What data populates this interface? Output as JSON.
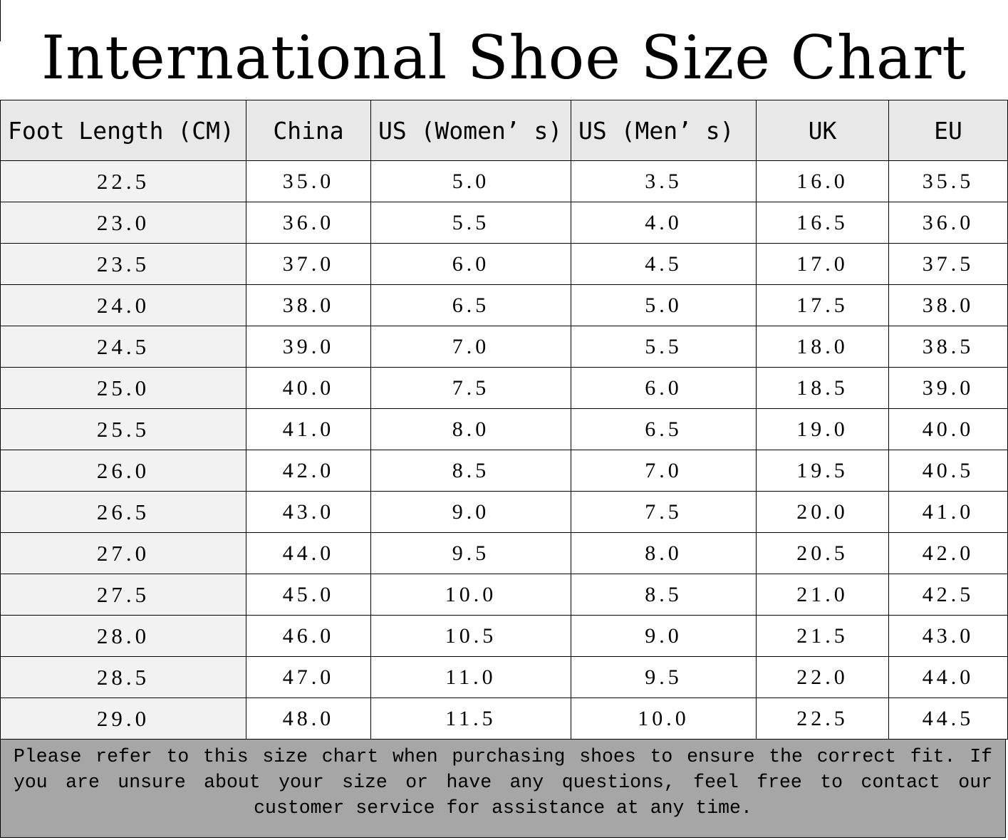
{
  "title": "International Shoe Size Chart",
  "table": {
    "headers": [
      "Foot Length (CM)",
      "China",
      "US (Women’ s)",
      "US (Men’ s)",
      "UK",
      "EU"
    ],
    "rows": [
      [
        "22.5",
        "35.0",
        "5.0",
        "3.5",
        "16.0",
        "35.5"
      ],
      [
        "23.0",
        "36.0",
        "5.5",
        "4.0",
        "16.5",
        "36.0"
      ],
      [
        "23.5",
        "37.0",
        "6.0",
        "4.5",
        "17.0",
        "37.5"
      ],
      [
        "24.0",
        "38.0",
        "6.5",
        "5.0",
        "17.5",
        "38.0"
      ],
      [
        "24.5",
        "39.0",
        "7.0",
        "5.5",
        "18.0",
        "38.5"
      ],
      [
        "25.0",
        "40.0",
        "7.5",
        "6.0",
        "18.5",
        "39.0"
      ],
      [
        "25.5",
        "41.0",
        "8.0",
        "6.5",
        "19.0",
        "40.0"
      ],
      [
        "26.0",
        "42.0",
        "8.5",
        "7.0",
        "19.5",
        "40.5"
      ],
      [
        "26.5",
        "43.0",
        "9.0",
        "7.5",
        "20.0",
        "41.0"
      ],
      [
        "27.0",
        "44.0",
        "9.5",
        "8.0",
        "20.5",
        "42.0"
      ],
      [
        "27.5",
        "45.0",
        "10.0",
        "8.5",
        "21.0",
        "42.5"
      ],
      [
        "28.0",
        "46.0",
        "10.5",
        "9.0",
        "21.5",
        "43.0"
      ],
      [
        "28.5",
        "47.0",
        "11.0",
        "9.5",
        "22.0",
        "44.0"
      ],
      [
        "29.0",
        "48.0",
        "11.5",
        "10.0",
        "22.5",
        "44.5"
      ]
    ]
  },
  "note": "Please refer to this size chart when purchasing shoes to ensure the correct fit. If you are unsure about your size or have any questions, feel free to contact our customer service for assistance at any time.",
  "colors": {
    "header_bg": "#e8e8e8",
    "first_column_bg": "#f2f2f2",
    "note_bg": "#a6a6a6",
    "border": "#000000"
  }
}
